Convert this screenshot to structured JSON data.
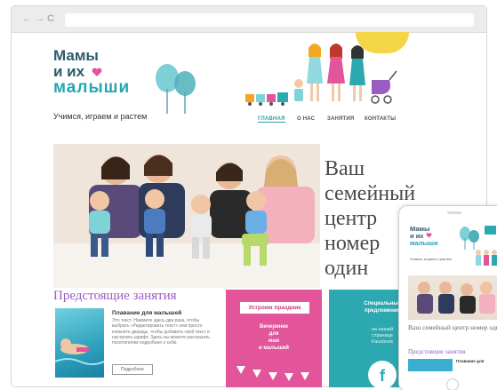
{
  "browser": {
    "back_glyph": "←",
    "forward_glyph": "→",
    "reload_glyph": "C"
  },
  "site": {
    "logo_line1": "Мамы",
    "logo_line2": "и их",
    "logo_line3": "малыши",
    "tagline": "Учимся, играем и растем"
  },
  "nav": {
    "items": [
      "ГЛАВНАЯ",
      "О НАС",
      "ЗАНЯТИЯ",
      "КОНТАКТЫ"
    ],
    "active_index": 0
  },
  "hero": {
    "lines": [
      "Ваш",
      "семейный",
      "центр",
      "номер",
      "один"
    ]
  },
  "upcoming": {
    "heading": "Предстоящие занятия",
    "lesson_title": "Плавание для малышей",
    "lesson_desc": "Это текст. Нажмите здесь два раза, чтобы выбрать «Редактировать текст» или просто кликните дважды, чтобы добавить свой текст и настроить шрифт. Здесь вы можете рассказать посетителям подробнее о себе.",
    "lesson_button": "Подробнее"
  },
  "party": {
    "badge": "Устроим праздник",
    "text_lines": [
      "Вечеринки",
      "для",
      "мам",
      "и малышей"
    ]
  },
  "special": {
    "title_lines": [
      "Специальные",
      "предложения"
    ],
    "sub_lines": [
      "на нашей",
      "странице",
      "Facebook"
    ],
    "fb_glyph": "f"
  },
  "tablet": {
    "logo_line1": "Мамы",
    "logo_line2": "и их",
    "logo_line3": "малыши",
    "tagline": "Учимся, играем и растем",
    "hero_text": "Ваш семейный центр номер один",
    "heading": "Предстоящие занятия",
    "lesson_title": "Плавание для"
  },
  "colors": {
    "brand_teal": "#2ba8b0",
    "brand_pink": "#e2559b",
    "heading_purple": "#9b5cc0",
    "logo_navy": "#2d5c6b"
  }
}
